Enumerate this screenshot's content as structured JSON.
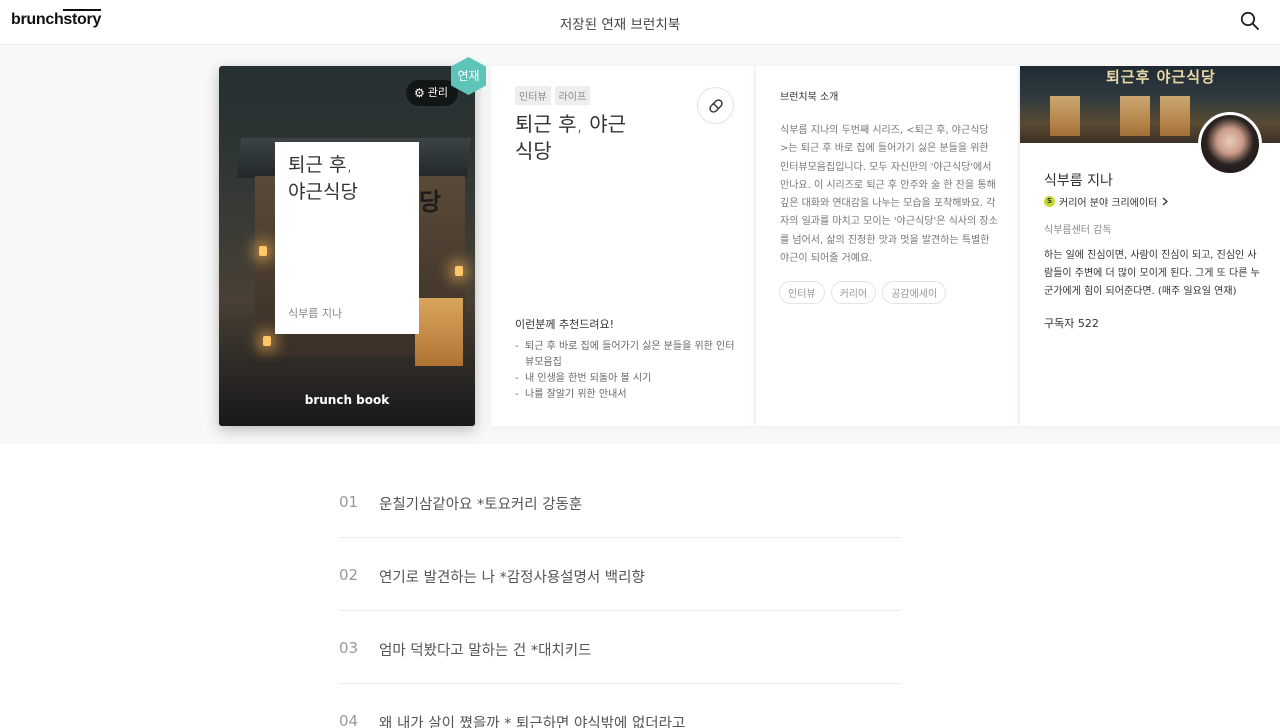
{
  "header": {
    "logo_brunch": "brunch",
    "logo_story": "story",
    "title": "저장된 연재 브런치북"
  },
  "cover": {
    "title": "퇴근 후,\n야근식당",
    "author": "식부름 지나",
    "manage_label": "관리",
    "badge": "연재",
    "brand": "brunch book",
    "sign_char": "당"
  },
  "info": {
    "tags": [
      "인터뷰",
      "라이프"
    ],
    "title": "퇴근 후, 야근\n식당",
    "recommend_title": "이런분께 추천드려요!",
    "recommend_items": [
      "퇴근 후 바로 집에 들어가기 싫은 분들을 위한 인터뷰모음집",
      "내 인생을 한번 되돌아 볼 시기",
      "나를 잘알기 위한 안내서"
    ]
  },
  "intro": {
    "heading": "브런치북 소개",
    "text": "식부름 지나의 두번째 시리즈, <퇴근 후, 야근식당 >는 퇴근 후 바로 집에 들어가기 싫은 분들을 위한 인터뷰모음집입니다. 모두 자신만의 '야근식당'에서 만나요. 이 시리즈로 퇴근 후 안주와 술 한 잔을 통해 깊은 대화와 연대감을 나누는 모습을 포착해봐요. 각자의 일과를 마치고 모이는 '야근식당'은 식사의 장소를 넘어서, 삶의 진정한 맛과 멋을 발견하는 특별한 야근이 되어줄 거예요.",
    "keywords": [
      "인터뷰",
      "커리어",
      "공감에세이"
    ]
  },
  "author": {
    "shop_sign": "퇴근후 야근식당",
    "name": "식부름 지나",
    "creator_label": "커리어 분야 크리에이터",
    "creator_badge": "S",
    "job": "식부름센터 감독",
    "description": "하는 일에 진심이면, 사람이 진심이 되고, 진심인 사람들이 주변에 더 많이 모이게 된다. 그게 또 다른 누군가에게 힘이 되어준다면. (매주 일요일 연재)",
    "subscribers": "구독자 522"
  },
  "episodes": [
    {
      "num": "01",
      "title": "운칠기삼같아요 *토요커리 강동훈"
    },
    {
      "num": "02",
      "title": "연기로 발견하는 나 *감정사용설명서 백리향"
    },
    {
      "num": "03",
      "title": "엄마 덕봤다고 말하는 건 *대치키드"
    },
    {
      "num": "04",
      "title": "왜 내가 살이 쪘을까 * 퇴근하면 야식밖에 없더라고"
    }
  ],
  "icons": {
    "search": "search-icon",
    "gear": "gear-icon",
    "like": "like-icon",
    "chevron": "chevron-right-icon"
  },
  "colors": {
    "badge": "#5ec4b8",
    "creator_badge": "#c9d831"
  }
}
